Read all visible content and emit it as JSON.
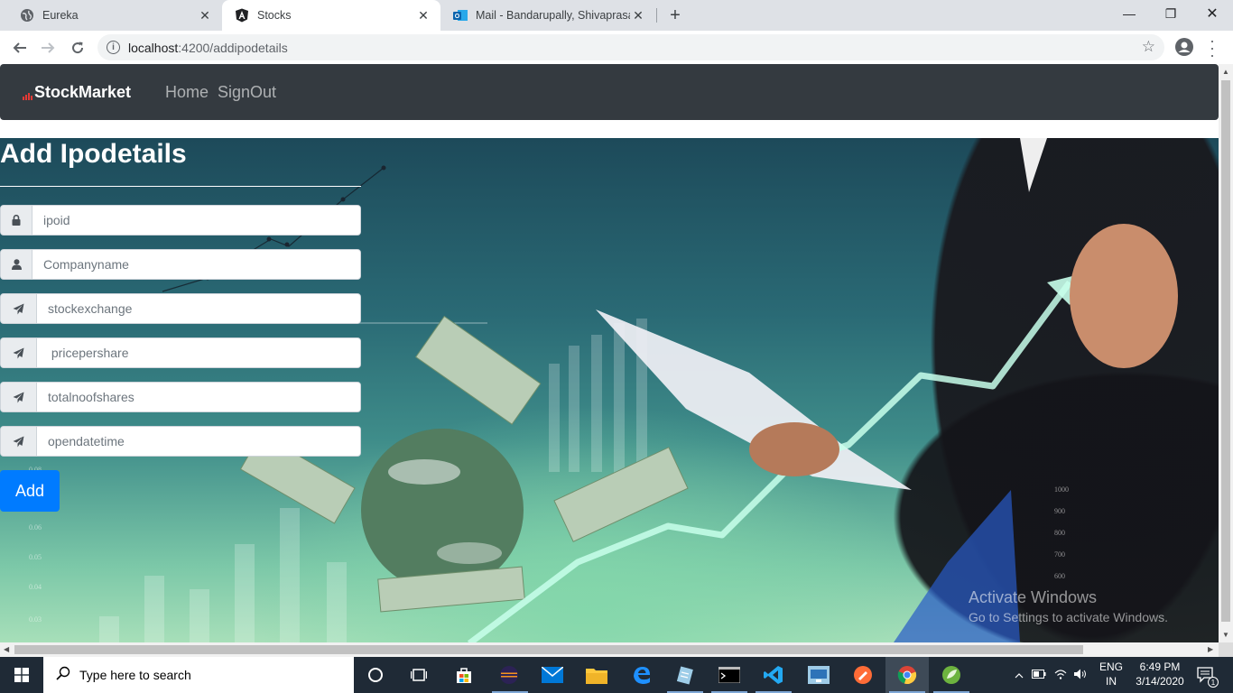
{
  "browser": {
    "tabs": [
      {
        "title": "Eureka",
        "active": false
      },
      {
        "title": "Stocks",
        "active": true
      },
      {
        "title": "Mail - Bandarupally, Shivaprasad",
        "active": false
      }
    ],
    "url_host": "localhost",
    "url_path": ":4200/addipodetails"
  },
  "navbar": {
    "brand": "StockMarket",
    "links": [
      "Home",
      "SignOut"
    ]
  },
  "form": {
    "title": "Add Ipodetails",
    "fields": [
      {
        "placeholder": "ipoid",
        "icon": "lock-icon"
      },
      {
        "placeholder": "Companyname",
        "icon": "user-icon"
      },
      {
        "placeholder": "stockexchange",
        "icon": "send-icon"
      },
      {
        "placeholder": " pricepershare",
        "icon": "send-icon"
      },
      {
        "placeholder": "totalnoofshares",
        "icon": "send-icon"
      },
      {
        "placeholder": "opendatetime",
        "icon": "send-icon"
      }
    ],
    "submit_label": "Add"
  },
  "watermark": {
    "line1": "Activate Windows",
    "line2": "Go to Settings to activate Windows."
  },
  "taskbar": {
    "search_placeholder": "Type here to search",
    "lang_line1": "ENG",
    "lang_line2": "IN",
    "time": "6:49 PM",
    "date": "3/14/2020",
    "notification_count": "1"
  },
  "colors": {
    "navbar_bg": "#343a40",
    "button_primary": "#007bff"
  }
}
